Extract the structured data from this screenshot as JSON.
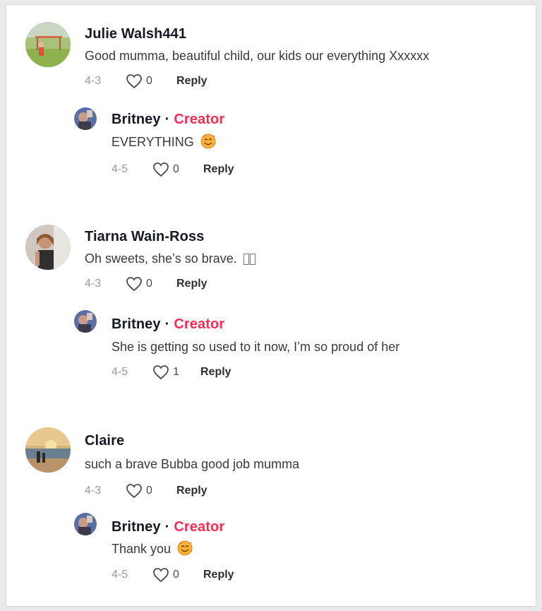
{
  "comments": [
    {
      "user": "Julie Walsh441",
      "text": "Good mumma, beautiful child, our kids our everything Xxxxxx",
      "date": "4-3",
      "likes": "0",
      "reply_label": "Reply",
      "reply": {
        "user": "Britney",
        "separator": "·",
        "badge": "Creator",
        "text": "EVERYTHING",
        "emoji": "smiling-face-with-hearts-icon",
        "date": "4-5",
        "likes": "0",
        "reply_label": "Reply"
      }
    },
    {
      "user": "Tiarna Wain-Ross",
      "text": "Oh sweets, she’s so brave.",
      "date": "4-3",
      "likes": "0",
      "reply_label": "Reply",
      "reply": {
        "user": "Britney",
        "separator": "·",
        "badge": "Creator",
        "text": "She is getting so used to it now, I’m so proud of her",
        "date": "4-5",
        "likes": "1",
        "reply_label": "Reply"
      }
    },
    {
      "user": "Claire",
      "text": "such a brave Bubba good job mumma",
      "date": "4-3",
      "likes": "0",
      "reply_label": "Reply",
      "reply": {
        "user": "Britney",
        "separator": "·",
        "badge": "Creator",
        "text": "Thank you",
        "emoji": "smiling-face-with-hearts-icon",
        "date": "4-5",
        "likes": "0",
        "reply_label": "Reply"
      }
    }
  ],
  "colors": {
    "creator": "#fe2c55",
    "date": "#9a9a9a",
    "text": "#3a3a3a"
  }
}
